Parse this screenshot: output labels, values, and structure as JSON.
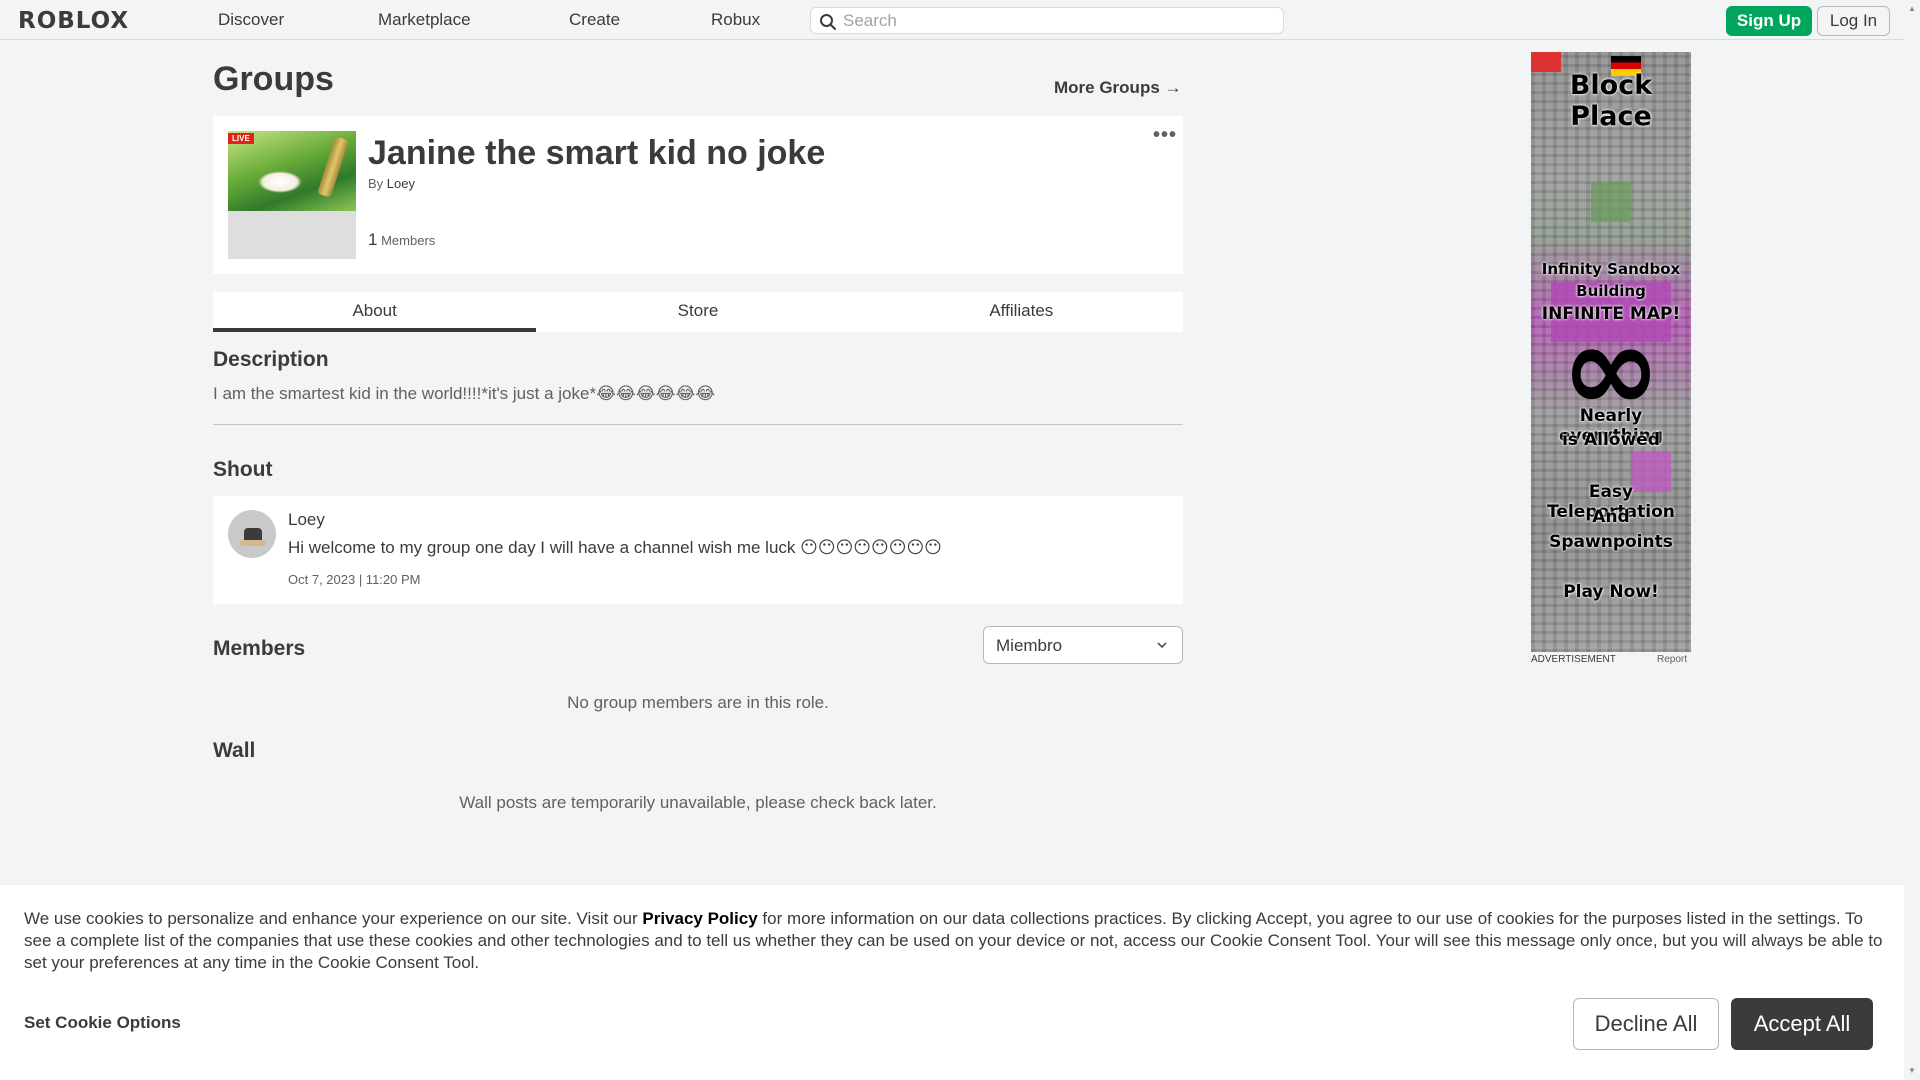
{
  "nav": {
    "logo": "ROBLOX",
    "links": [
      "Discover",
      "Marketplace",
      "Create",
      "Robux"
    ],
    "search_placeholder": "Search",
    "signup": "Sign Up",
    "login": "Log In"
  },
  "page": {
    "title": "Groups",
    "more_groups": "More Groups →"
  },
  "group": {
    "live_badge": "LIVE",
    "name": "Janine the smart kid no joke",
    "by_prefix": "By",
    "owner": "Loey",
    "member_count": "1",
    "members_label": "Members",
    "more_menu": "•••"
  },
  "tabs": [
    "About",
    "Store",
    "Affiliates"
  ],
  "description": {
    "title": "Description",
    "text": "I am the smartest kid in the world!!!!*it's just a joke*😂😂😂😂😂😂"
  },
  "shout": {
    "title": "Shout",
    "author": "Loey",
    "body": "Hi welcome to my group one day I will have a channel wish me luck 😶😶😶😶😶😶😶😶",
    "date": "Oct 7, 2023 | 11:20 PM"
  },
  "members": {
    "title": "Members",
    "role_selected": "Miembro",
    "empty": "No group members are in this role."
  },
  "wall": {
    "title": "Wall",
    "empty": "Wall posts are temporarily unavailable, please check back later."
  },
  "ad": {
    "title": "Block Place",
    "line1": "Infinity Sandbox",
    "line2": "Building",
    "line3": "INFINITE MAP!",
    "line4": "Nearly everything",
    "line5": "is Allowed",
    "line6": "Easy Teleportation",
    "line7": "And",
    "line8": "Spawnpoints",
    "cta": "Play Now!",
    "label": "ADVERTISEMENT",
    "report": "Report"
  },
  "cookie": {
    "text_before": "We use cookies to personalize and enhance your experience on our site. Visit our ",
    "privacy_link": "Privacy Policy",
    "text_after": " for more information on our data collections practices. By clicking Accept, you agree to our use of cookies for the purposes listed in the settings. To see a complete list of the companies that use these cookies and other technologies and to tell us whether they can be used on your device or not, access our Cookie Consent Tool. Your will see this message only once, but you will always be able to set your preferences at any time in the Cookie Consent Tool.",
    "options": "Set Cookie Options",
    "decline": "Decline All",
    "accept": "Accept All"
  },
  "colors": {
    "background": "#f2f4f5",
    "signup_green": "#00a65d",
    "accept_dark": "#393b3d",
    "live_red": "#e2231a"
  }
}
